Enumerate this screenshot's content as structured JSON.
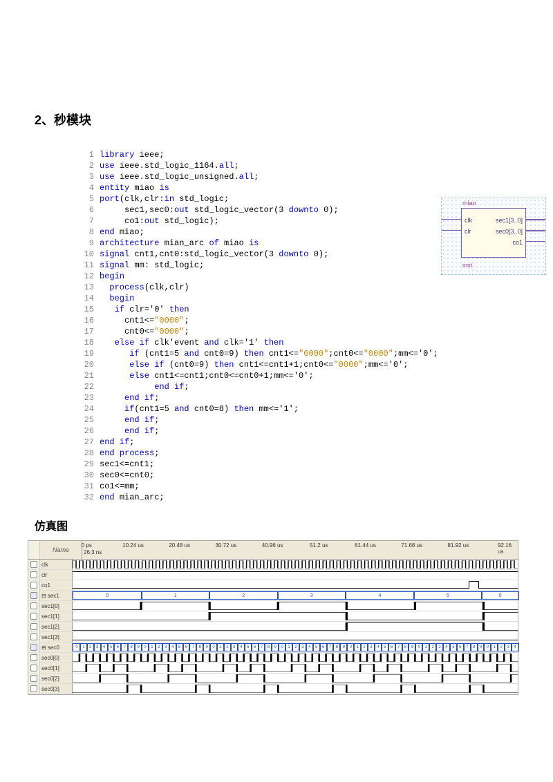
{
  "section_title": "2、秒模块",
  "subtitle": "仿真图",
  "code": {
    "lines": [
      {
        "n": 1,
        "segs": [
          {
            "t": "library ",
            "c": "kw"
          },
          {
            "t": "ieee;"
          }
        ]
      },
      {
        "n": 2,
        "segs": [
          {
            "t": "use ",
            "c": "kw"
          },
          {
            "t": "ieee.std_logic_1164."
          },
          {
            "t": "all",
            "c": "kw"
          },
          {
            "t": ";"
          }
        ]
      },
      {
        "n": 3,
        "segs": [
          {
            "t": "use ",
            "c": "kw"
          },
          {
            "t": "ieee.std_logic_unsigned."
          },
          {
            "t": "all",
            "c": "kw"
          },
          {
            "t": ";"
          }
        ]
      },
      {
        "n": 4,
        "segs": [
          {
            "t": "entity ",
            "c": "kw"
          },
          {
            "t": "miao "
          },
          {
            "t": "is",
            "c": "kw"
          }
        ]
      },
      {
        "n": 5,
        "segs": [
          {
            "t": "port",
            "c": "kw"
          },
          {
            "t": "(clk,clr:"
          },
          {
            "t": "in ",
            "c": "kw"
          },
          {
            "t": "std_logic;"
          }
        ]
      },
      {
        "n": 6,
        "segs": [
          {
            "t": "     sec1,sec0:"
          },
          {
            "t": "out ",
            "c": "kw"
          },
          {
            "t": "std_logic_vector(3 "
          },
          {
            "t": "downto ",
            "c": "kw"
          },
          {
            "t": "0);"
          }
        ]
      },
      {
        "n": 7,
        "segs": [
          {
            "t": "     co1:"
          },
          {
            "t": "out ",
            "c": "kw"
          },
          {
            "t": "std_logic);"
          }
        ]
      },
      {
        "n": 8,
        "segs": [
          {
            "t": "end ",
            "c": "kw"
          },
          {
            "t": "miao;"
          }
        ]
      },
      {
        "n": 9,
        "segs": [
          {
            "t": "architecture ",
            "c": "kw"
          },
          {
            "t": "mian_arc "
          },
          {
            "t": "of ",
            "c": "kw"
          },
          {
            "t": "miao "
          },
          {
            "t": "is",
            "c": "kw"
          }
        ]
      },
      {
        "n": 10,
        "segs": [
          {
            "t": "signal ",
            "c": "kw"
          },
          {
            "t": "cnt1,cnt0:std_logic_vector(3 "
          },
          {
            "t": "downto ",
            "c": "kw"
          },
          {
            "t": "0);"
          }
        ]
      },
      {
        "n": 11,
        "segs": [
          {
            "t": "signal ",
            "c": "kw"
          },
          {
            "t": "mm: std_logic;"
          }
        ]
      },
      {
        "n": 12,
        "segs": [
          {
            "t": "begin",
            "c": "kw"
          }
        ]
      },
      {
        "n": 13,
        "segs": [
          {
            "t": "  process",
            "c": "kw"
          },
          {
            "t": "(clk,clr)"
          }
        ]
      },
      {
        "n": 14,
        "segs": [
          {
            "t": "  begin",
            "c": "kw"
          }
        ]
      },
      {
        "n": 15,
        "segs": [
          {
            "t": "   if ",
            "c": "kw"
          },
          {
            "t": "clr='0' "
          },
          {
            "t": "then",
            "c": "kw"
          }
        ]
      },
      {
        "n": 16,
        "segs": [
          {
            "t": "     cnt1<="
          },
          {
            "t": "\"0000\"",
            "c": "str"
          },
          {
            "t": ";"
          }
        ]
      },
      {
        "n": 17,
        "segs": [
          {
            "t": "     cnt0<="
          },
          {
            "t": "\"0000\"",
            "c": "str"
          },
          {
            "t": ";"
          }
        ]
      },
      {
        "n": 18,
        "segs": [
          {
            "t": "   else if ",
            "c": "kw"
          },
          {
            "t": "clk'event "
          },
          {
            "t": "and ",
            "c": "kw"
          },
          {
            "t": "clk='1' "
          },
          {
            "t": "then",
            "c": "kw"
          }
        ]
      },
      {
        "n": 19,
        "segs": [
          {
            "t": "      if ",
            "c": "kw"
          },
          {
            "t": "(cnt1=5 "
          },
          {
            "t": "and ",
            "c": "kw"
          },
          {
            "t": "cnt0=9) "
          },
          {
            "t": "then ",
            "c": "kw"
          },
          {
            "t": "cnt1<="
          },
          {
            "t": "\"0000\"",
            "c": "str"
          },
          {
            "t": ";cnt0<="
          },
          {
            "t": "\"0000\"",
            "c": "str"
          },
          {
            "t": ";mm<='0';"
          }
        ]
      },
      {
        "n": 20,
        "segs": [
          {
            "t": "      else if ",
            "c": "kw"
          },
          {
            "t": "(cnt0=9) "
          },
          {
            "t": "then ",
            "c": "kw"
          },
          {
            "t": "cnt1<=cnt1+1;cnt0<="
          },
          {
            "t": "\"0000\"",
            "c": "str"
          },
          {
            "t": ";mm<='0';"
          }
        ]
      },
      {
        "n": 21,
        "segs": [
          {
            "t": "      else ",
            "c": "kw"
          },
          {
            "t": "cnt1<=cnt1;cnt0<=cnt0+1;mm<='0';"
          }
        ]
      },
      {
        "n": 22,
        "segs": [
          {
            "t": "           end if",
            "c": "kw"
          },
          {
            "t": ";"
          }
        ]
      },
      {
        "n": 23,
        "segs": [
          {
            "t": "     end if",
            "c": "kw"
          },
          {
            "t": ";"
          }
        ]
      },
      {
        "n": 24,
        "segs": [
          {
            "t": "     if",
            "c": "kw"
          },
          {
            "t": "(cnt1=5 "
          },
          {
            "t": "and ",
            "c": "kw"
          },
          {
            "t": "cnt0=8) "
          },
          {
            "t": "then ",
            "c": "kw"
          },
          {
            "t": "mm<='1';"
          }
        ]
      },
      {
        "n": 25,
        "segs": [
          {
            "t": "     end if",
            "c": "kw"
          },
          {
            "t": ";"
          }
        ]
      },
      {
        "n": 26,
        "segs": [
          {
            "t": "     end if",
            "c": "kw"
          },
          {
            "t": ";"
          }
        ]
      },
      {
        "n": 27,
        "segs": [
          {
            "t": "end if",
            "c": "kw"
          },
          {
            "t": ";"
          }
        ]
      },
      {
        "n": 28,
        "segs": [
          {
            "t": "end process",
            "c": "kw"
          },
          {
            "t": ";"
          }
        ]
      },
      {
        "n": 29,
        "segs": [
          {
            "t": "sec1<=cnt1;"
          }
        ]
      },
      {
        "n": 30,
        "segs": [
          {
            "t": "sec0<=cnt0;"
          }
        ]
      },
      {
        "n": 31,
        "segs": [
          {
            "t": "co1<=mm;"
          }
        ]
      },
      {
        "n": 32,
        "segs": [
          {
            "t": "end ",
            "c": "kw"
          },
          {
            "t": "mian_arc;"
          }
        ]
      }
    ]
  },
  "block": {
    "title": "miao",
    "inst": "inst",
    "pins_left": [
      "clk",
      "clr"
    ],
    "pins_right": [
      "sec1[3..0]",
      "sec0[3..0]",
      "co1"
    ]
  },
  "waveform": {
    "name_header": "Name",
    "cursor": "26.3 ns",
    "ticks": [
      "0 ps",
      "10.24 us",
      "20.48 us",
      "30.72 us",
      "40.96 us",
      "51.2 us",
      "61.44 us",
      "71.68 us",
      "81.92 us",
      "92.16 us"
    ],
    "signals": [
      {
        "name": "clk",
        "type": "clock"
      },
      {
        "name": "clr",
        "type": "high"
      },
      {
        "name": "co1",
        "type": "pulse_late"
      },
      {
        "name": "sec1",
        "type": "bus",
        "values": [
          "0",
          "1",
          "2",
          "3",
          "4",
          "5",
          "0"
        ],
        "expand": true
      },
      {
        "name": "sec1[0]",
        "type": "toggle",
        "period": 2,
        "phase": 1
      },
      {
        "name": "sec1[1]",
        "type": "toggle",
        "period": 4,
        "phase": 2
      },
      {
        "name": "sec1[2]",
        "type": "toggle",
        "period": 8,
        "phase": 4
      },
      {
        "name": "sec1[3]",
        "type": "low"
      },
      {
        "name": "sec0",
        "type": "bus10",
        "expand": true
      },
      {
        "name": "sec0[0]",
        "type": "toggle",
        "period": 0.2,
        "phase": 0
      },
      {
        "name": "sec0[1]",
        "type": "pattern01"
      },
      {
        "name": "sec0[2]",
        "type": "pattern02"
      },
      {
        "name": "sec0[3]",
        "type": "pattern03"
      }
    ]
  }
}
